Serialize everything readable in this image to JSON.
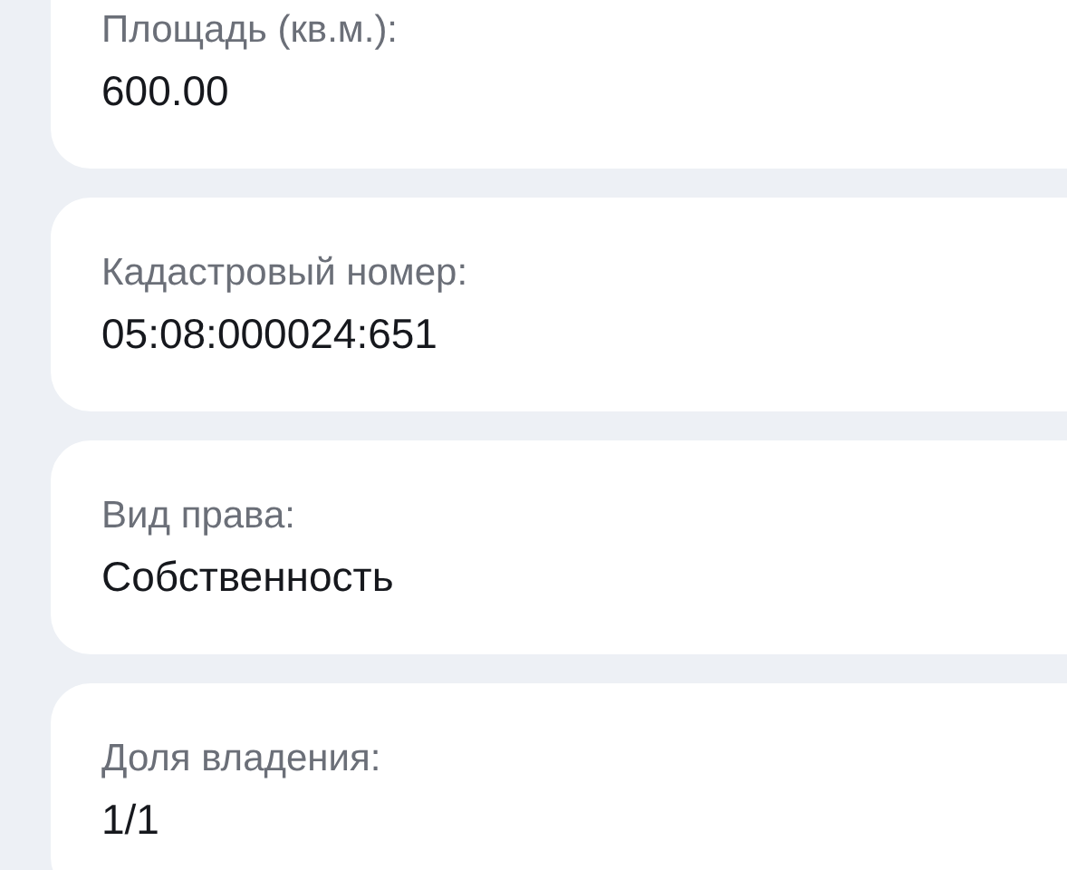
{
  "fields": [
    {
      "label": "Площадь (кв.м.):",
      "value": "600.00"
    },
    {
      "label": "Кадастровый номер:",
      "value": "05:08:000024:651"
    },
    {
      "label": "Вид права:",
      "value": "Собственность"
    },
    {
      "label": "Доля владения:",
      "value": "1/1"
    }
  ]
}
